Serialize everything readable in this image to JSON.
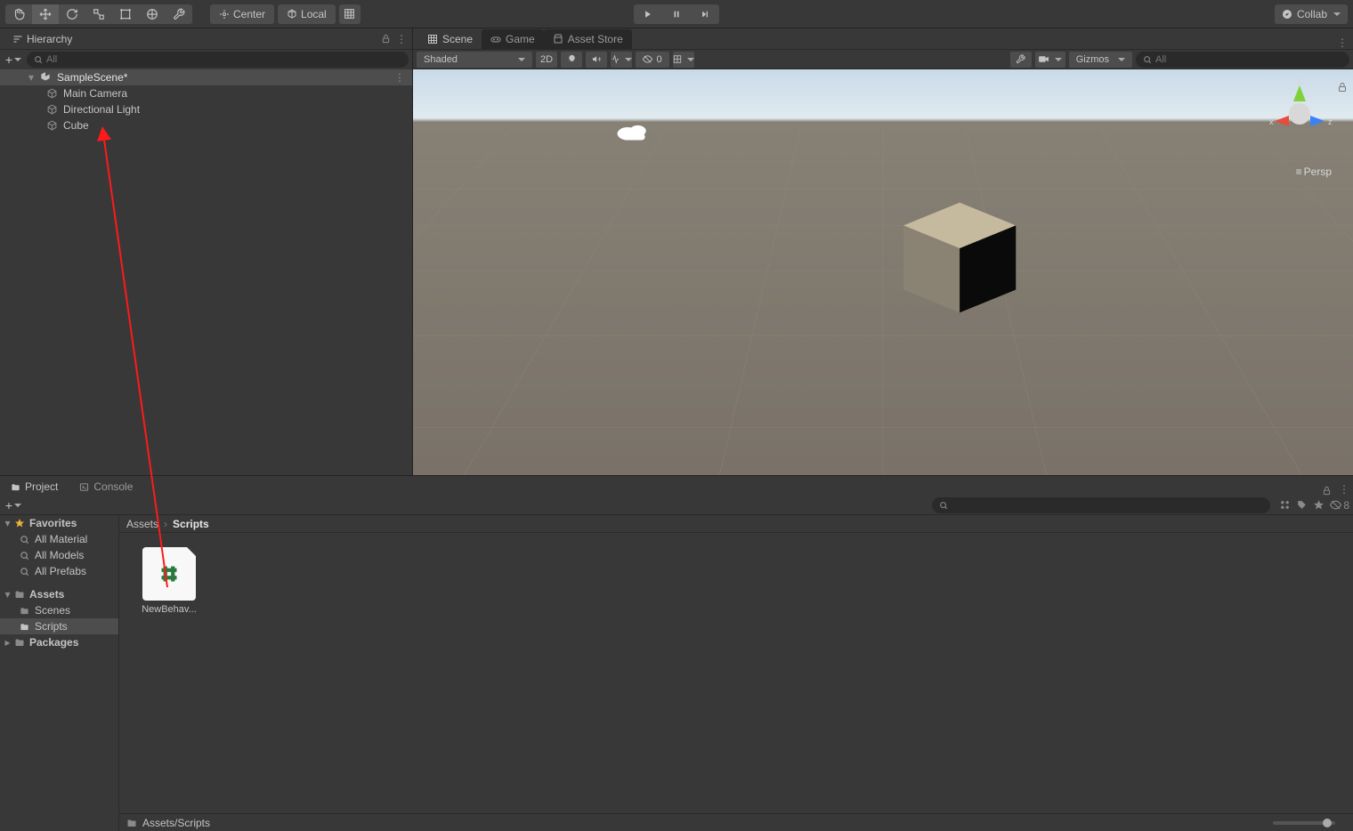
{
  "app": "Unity Editor",
  "top_toolbar": {
    "pivot_label": "Center",
    "handle_label": "Local",
    "collab_label": "Collab"
  },
  "hierarchy": {
    "title": "Hierarchy",
    "search_placeholder": "All",
    "scene_name": "SampleScene*",
    "items": [
      {
        "label": "Main Camera"
      },
      {
        "label": "Directional Light"
      },
      {
        "label": "Cube"
      }
    ]
  },
  "scene_view": {
    "tabs": [
      {
        "label": "Scene",
        "active": true
      },
      {
        "label": "Game",
        "active": false
      },
      {
        "label": "Asset Store",
        "active": false
      }
    ],
    "shading": "Shaded",
    "mode_2d": "2D",
    "audio_mute_count": "0",
    "gizmos_label": "Gizmos",
    "search_placeholder": "All",
    "axis": {
      "x": "x",
      "y": "y",
      "z": "z"
    },
    "projection_label": "Persp"
  },
  "project_panel": {
    "tabs": [
      {
        "label": "Project",
        "active": true
      },
      {
        "label": "Console",
        "active": false
      }
    ],
    "hidden_count": "8",
    "tree": {
      "favorites_label": "Favorites",
      "favorites": [
        {
          "label": "All Material"
        },
        {
          "label": "All Models"
        },
        {
          "label": "All Prefabs"
        }
      ],
      "assets_label": "Assets",
      "assets": [
        {
          "label": "Scenes"
        },
        {
          "label": "Scripts",
          "selected": true
        }
      ],
      "packages_label": "Packages"
    },
    "breadcrumb": [
      "Assets",
      "Scripts"
    ],
    "items": [
      {
        "label": "NewBehav...",
        "type": "script"
      }
    ],
    "status_path": "Assets/Scripts"
  }
}
